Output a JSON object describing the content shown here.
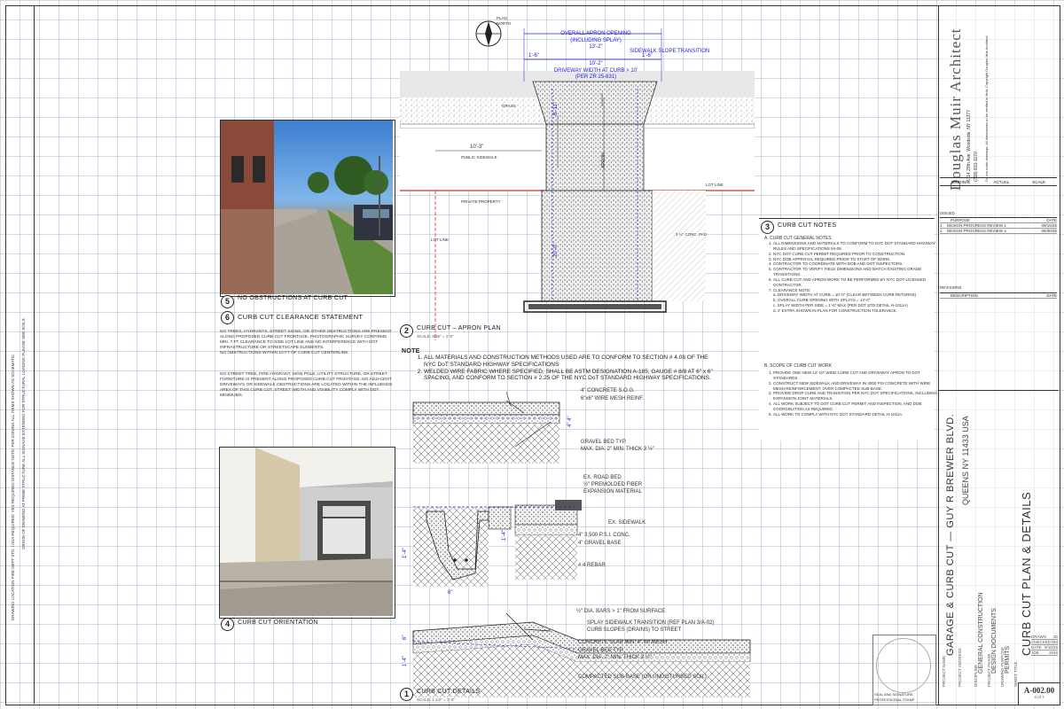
{
  "firm": {
    "name": "Douglas Muir Architect",
    "address_line1": "6114 29th Ave, Woodside, NY 11377",
    "phone": "(718) 831-1170",
    "notes_vertical": "Do not scale drawings. All dimensions to be verified in field. Copyright Douglas Muir Architect."
  },
  "title_block": {
    "original_label": "ORIGINAL",
    "actual_label": "ACTUAL",
    "scale_label": "SCALE",
    "issued_label": "ISSUED",
    "issued_col_purpose": "PURPOSE",
    "issued_col_date": "DATE",
    "issued_rows": [
      {
        "no": "1",
        "purpose": "DESIGN PROGRESS REVIEW 1",
        "date": "09/15/25"
      },
      {
        "no": "2",
        "purpose": "DESIGN PROGRESS REVIEW 2",
        "date": "09/30/25"
      }
    ],
    "revisions_label": "REVISIONS",
    "rev_col_desc": "DESCRIPTION",
    "rev_col_date": "DATE",
    "project_name_label": "PROJECT NAME",
    "project_name": "GARAGE & CURB CUT — GUY R BREWER BLVD.",
    "project_address_label": "PROJECT ADDRESS",
    "project_address": "QUEENS NY 11433 USA",
    "discipline_label": "DISCIPLINE",
    "discipline": "GENERAL CONSTRUCTION",
    "phase_label": "PROJECT PHASE",
    "phase": "DESIGN DOCUMENTS",
    "drawing_label": "DRAWING PURPOSE",
    "drawing_purpose": "PERMITS",
    "sheet_title_label": "SHEET TITLE",
    "sheet_title": "CURB CUT PLAN & DETAILS",
    "sheet_number": "A-002.00",
    "sheet_count": "4 of 7",
    "stamp_label": "SEAL AND SIGNATURE",
    "stamp_note": "PROFESSIONAL STAMP",
    "meta_rows": [
      {
        "label": "DRAWN",
        "value": "JD"
      },
      {
        "label": "CHECKED",
        "value": "DM"
      },
      {
        "label": "DATE",
        "value": "9/15/25"
      },
      {
        "label": "JOB",
        "value": "2516"
      }
    ]
  },
  "drawings": {
    "photo_no_obstructions": {
      "num": "5",
      "title": "NO OBSTRUCTIONS AT CURB CUT"
    },
    "statement": {
      "num": "6",
      "title": "CURB CUT CLEARANCE STATEMENT",
      "para1": "NO TREES, HYDRANTS, STREET SIGNS, OR OTHER OBSTRUCTIONS ARE PRESENT ALONG PROPOSED CURB CUT FRONTAGE. PHOTOGRAPHIC SURVEY CONFIRMS MIN. 7 FT CLEARANCE TO SIDE LOT LINE AND NO INTERFERENCE WITH DOT INFRASTRUCTURE OR STREETSCAPE ELEMENTS.\nNO OBSTRUCTIONS WITHIN 10 FT OF CURB CUT CENTERLINE.",
      "para2": "NO STREET TREE, FIRE HYDRANT, SIGN POLE, UTILITY STRUCTURE, OR STREET FURNITURE IS PRESENT ALONG PROPOSED CURB CUT FRONTAGE. NO ADJACENT DRIVEWAYS OR SIDEWALK OBSTRUCTIONS ARE LOCATED WITHIN THE INFLUENCE AREA OF THIS CURB CUT. STREET WIDTH AND VISIBILITY COMPLY WITH DOT MINIMUMS."
    },
    "orientation": {
      "num": "4",
      "title": "CURB CUT ORIENTATION"
    },
    "apron_plan": {
      "num": "2",
      "title": "CURB CUT – APRON PLAN",
      "scale": "SCALE: 3/16\" = 1'-0\"",
      "overall_label": "OVERALL APRON OPENING\n(INCLUDING SPLAY)\n13'-2\"",
      "transition_label": "SIDEWALK SLOPE TRANSITION",
      "splay_left": "1'-6\"",
      "splay_right": "1'-6\"",
      "driveway_label": "10'-2\"\nDRIVEWAY WIDTH AT CURB > 10'\n(PER ZR 25-631)",
      "grass": "GRASS",
      "public_sidewalk": "PUBLIC SIDEWALK",
      "sidewalk_dim": "10'-3\"",
      "private_property": "PRIVATE PROPERTY",
      "lot_line_top": "LOT LINE",
      "lot_line_left": "LOT LINE",
      "conc_pad": "3 ½\" CONC. PAD",
      "apron_dim": "6'-11\"",
      "apron_vert": "APRON",
      "depth_dim": "20'-0\"",
      "north": "PLAN\nNORTH"
    },
    "notes_block": {
      "num": "3",
      "title": "CURB CUT NOTES",
      "section_a": "A. CURB CUT GENERAL NOTES",
      "notes": [
        "ALL DIMENSIONS AND MATERIALS TO CONFORM TO NYC DOT STANDARD HIGHWAY RULES AND SPECIFICATIONS 84-08.",
        "NYC DOT CURB CUT PERMIT REQUIRED PRIOR TO CONSTRUCTION.",
        "NYC DOB APPROVAL REQUIRED PRIOR TO START OF WORK.",
        "CONTRACTOR TO COORDINATE WITH DOB AND DOT INSPECTORS.",
        "CONTRACTOR TO VERIFY FIELD DIMENSIONS AND MATCH EXISTING GRADE TRANSITIONS.",
        "ALL CURB CUT AND APRON WORK TO BE PERFORMED BY NYC DOT-LICENSED CONTRACTOR.",
        "CLEARANCE NOTE:\na. DRIVEWAY WIDTH AT CURB = 10'-0\" (CLEAR BETWEEN CURB RETURNS)\nb. OVERALL CURB OPENING WITH SPLAYS = 13'-0\"\nc. SPLAY WIDTH PER SIDE = 1'-6\" MAX (PER DOT STD DETAIL H-1011A)\nd. 2' EXTRA SHOWN IN PLAN FOR CONSTRUCTION TOLERANCE."
      ],
      "section_b": "B. SCOPE OF CURB CUT WORK",
      "scope": [
        "PROVIDE ONE NEW 12'-10\" WIDE CURB CUT AND DRIVEWAY APRON TO DOT STANDARDS.",
        "CONSTRUCT NEW SIDEWALK AND DRIVEWAY IN 4000 PSI CONCRETE WITH WIRE MESH REINFORCEMENT, OVER COMPACTED SUB-BASE.",
        "PROVIDE DROP CURB AND TRANSITION PER NYC DOT SPECIFICATIONS, INCLUDING EXPANSION JOINT MATERIALS.",
        "ALL WORK SUBJECT TO DOT CURB CUT PERMIT AND INSPECTION, AND DOB COORDINATION AS REQUIRED.",
        "ALL WORK TO COMPLY WITH NYC DOT STANDARD DETAIL H-1011A."
      ]
    },
    "details": {
      "num": "1",
      "title": "CURB CUT DETAILS",
      "scale": "SCALE: 1 1/2\" = 1'-0\"",
      "note_head": "NOTE",
      "note1": "ALL MATERIALS AND CONSTRUCTION METHODS USED ARE TO CONFORM TO SECTION # 4.08 OF THE NYC DoT STANDARD HIGHWAY SPECIFICATIONS",
      "note2": "WELDED WIRE FABRIC WHERE SPECIFIED, SHALL BE ASTM DESIGNATION A-185, GAUGE # 8/8 AT 6\" x 6\" SPACING, AND CONFORM TO SECTION # 2.25 OF THE NYC DoT STANDARD HIGHWAY SPECIFICATIONS.",
      "d1_labels": [
        "4\" CONCRETE S.O.G.",
        "6\"x6\" WIRE MESH REINF.",
        "GRAVEL BED TYP.\nMAX. DIA. 2\" MIN. THICK 3 ½\""
      ],
      "d1_dim": "4\" 4\"",
      "d2_labels": [
        "EX. ROAD BED",
        "½\" PREMOLDED FIBER\nEXPANSION MATERIAL",
        "EX. SIDEWALK",
        "4\" 3,500 P.S.I. CONC.",
        "4\" GRAVEL BASE",
        "# 4 REBAR"
      ],
      "d2_dims": [
        "1'-4\"",
        "6\"",
        "1'-4\""
      ],
      "d3_labels": [
        "½\" DIA. BARS > 1\" FROM SURFACE",
        "SPLAY SIDEWALK TRANSITION (REF PLAN 3/A-02)\nCURB SLOPES (DRAINS) TO STREET",
        "CONCRETE SLAB MIN. 4\" W/ MESH",
        "GRAVEL BED TYP.\nMAX. DIA. 2\" MIN. THICK 3 ½\"",
        "COMPACTED SUB-BASE (OR UNDISTURBED SOIL)"
      ],
      "d3_dims": [
        "6\"",
        "1'-4\""
      ]
    }
  },
  "left_strip": {
    "block1": "DRAWING LOCATION\nFIRE DEPT STD. / ADA REQUIRED: YES\nREQUIRED DISTANCE NOTE: PER ZONING\nALL ITEMS SHOWN AS SCHEMATIC",
    "block2": "ORIGIN OF DRAWING AT PRIME STRUCTURE\nALL SIGNAGE EXTENDED\nFOR STRUCTURAL LOADING PLEASE SEE SOILS"
  }
}
